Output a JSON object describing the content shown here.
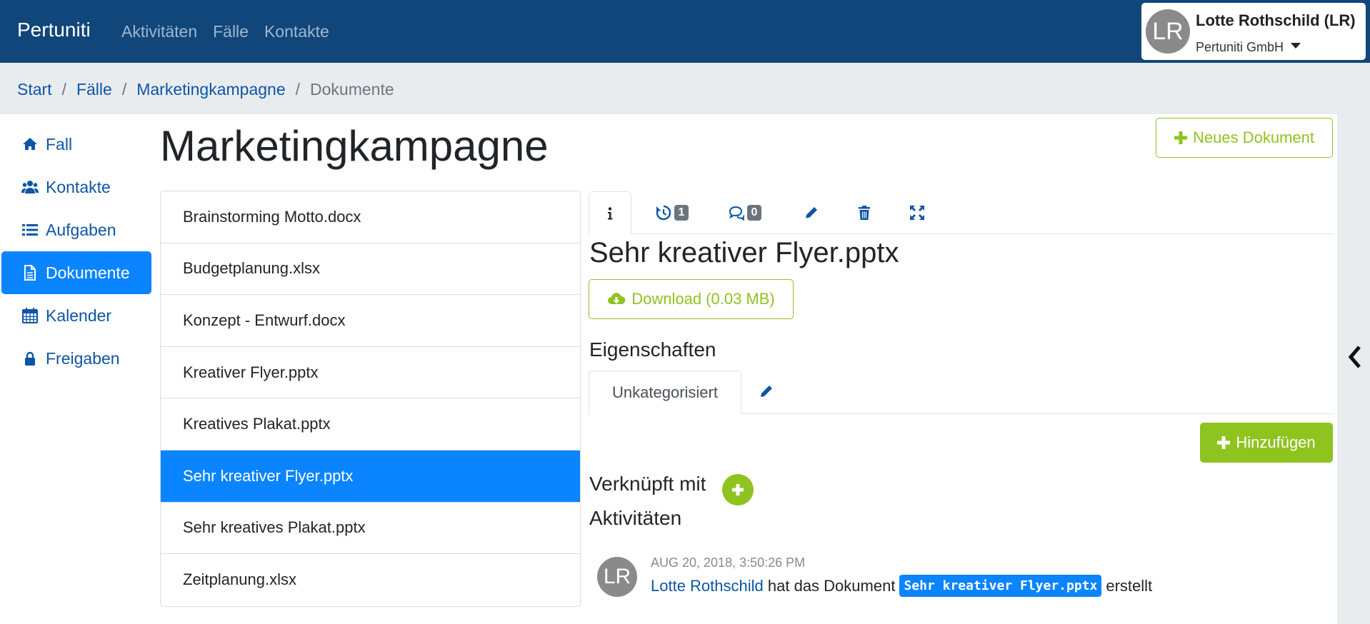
{
  "navbar": {
    "brand": "Pertuniti",
    "links": [
      "Aktivitäten",
      "Fälle",
      "Kontakte"
    ],
    "user": {
      "initials": "LR",
      "name": "Lotte Rothschild (LR)",
      "company": "Pertuniti GmbH"
    }
  },
  "breadcrumb": {
    "items": [
      "Start",
      "Fälle",
      "Marketingkampagne"
    ],
    "current": "Dokumente",
    "separator": "/"
  },
  "sidebar": {
    "items": [
      {
        "label": "Fall",
        "icon": "home-icon"
      },
      {
        "label": "Kontakte",
        "icon": "users-icon"
      },
      {
        "label": "Aufgaben",
        "icon": "list-icon"
      },
      {
        "label": "Dokumente",
        "icon": "file-icon",
        "active": true
      },
      {
        "label": "Kalender",
        "icon": "calendar-icon"
      },
      {
        "label": "Freigaben",
        "icon": "lock-icon"
      }
    ]
  },
  "page": {
    "title": "Marketingkampagne",
    "new_document_label": "Neues Dokument"
  },
  "documents": [
    "Brainstorming Motto.docx",
    "Budgetplanung.xlsx",
    "Konzept - Entwurf.docx",
    "Kreativer Flyer.pptx",
    "Kreatives Plakat.pptx",
    "Sehr kreativer Flyer.pptx",
    "Sehr kreatives Plakat.pptx",
    "Zeitplanung.xlsx"
  ],
  "detail": {
    "tabs": {
      "history_count": "1",
      "comments_count": "0"
    },
    "title": "Sehr kreativer Flyer.pptx",
    "download_label": "Download (0.03 MB)",
    "properties_heading": "Eigenschaften",
    "category_tab": "Unkategorisiert",
    "add_label": "Hinzufügen",
    "linked_heading": "Verknüpft mit",
    "activities_heading": "Aktivitäten",
    "activity": {
      "initials": "LR",
      "timestamp": "AUG 20, 2018, 3:50:26 PM",
      "user": "Lotte Rothschild",
      "text_before": "hat das Dokument",
      "document": "Sehr kreativer Flyer.pptx",
      "text_after": "erstellt"
    }
  },
  "colors": {
    "navbar": "#10467a",
    "primary": "#0a84ff",
    "link": "#0d55a6",
    "success": "#8fc31f"
  }
}
